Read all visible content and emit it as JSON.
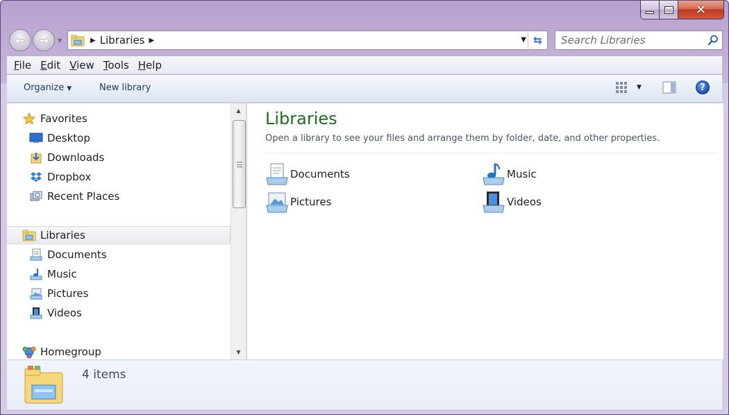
{
  "window": {
    "caption_close": "✕"
  },
  "navbar": {
    "address_path": "Libraries",
    "search_placeholder": "Search Libraries"
  },
  "menubar": {
    "items": [
      {
        "ul": "F",
        "rest": "ile"
      },
      {
        "ul": "E",
        "rest": "dit"
      },
      {
        "ul": "V",
        "rest": "iew"
      },
      {
        "ul": "T",
        "rest": "ools"
      },
      {
        "ul": "H",
        "rest": "elp"
      }
    ]
  },
  "cmdbar": {
    "organize": "Organize",
    "new_library": "New library",
    "help": "?"
  },
  "navpane": {
    "favorites": "Favorites",
    "desktop": "Desktop",
    "downloads": "Downloads",
    "dropbox": "Dropbox",
    "recent_places": "Recent Places",
    "libraries": "Libraries",
    "documents": "Documents",
    "music": "Music",
    "pictures": "Pictures",
    "videos": "Videos",
    "homegroup": "Homegroup"
  },
  "content": {
    "title": "Libraries",
    "description": "Open a library to see your files and arrange them by folder, date, and other properties.",
    "items": [
      "Documents",
      "Music",
      "Pictures",
      "Videos"
    ]
  },
  "details": {
    "count": "4 items"
  },
  "colors": {
    "title_green": "#1f6e1f",
    "accent_blue": "#2d6bc4",
    "close_red": "#c2391d"
  }
}
